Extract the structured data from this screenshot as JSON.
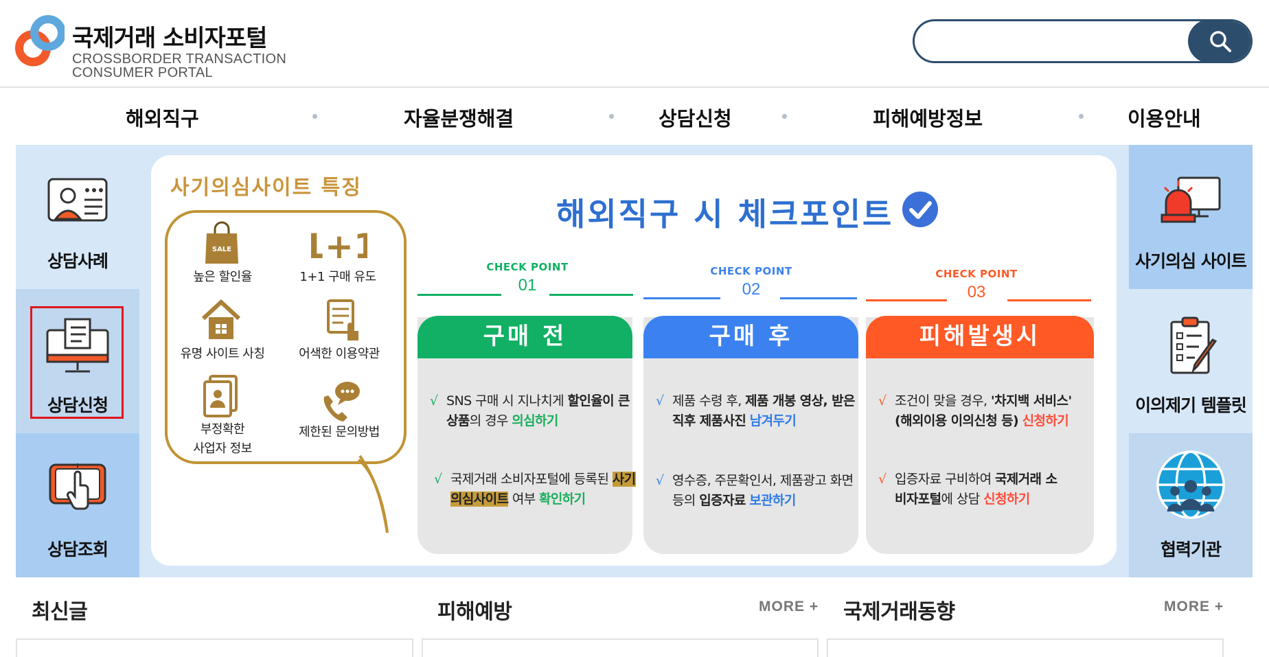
{
  "site": {
    "title": "국제거래 소비자포털",
    "subtitle_line1": "CROSSBORDER TRANSACTION",
    "subtitle_line2": "CONSUMER PORTAL"
  },
  "search": {
    "placeholder": "",
    "value": "",
    "icon": "search-icon"
  },
  "nav": {
    "items": [
      {
        "label": "해외직구"
      },
      {
        "label": "자율분쟁해결"
      },
      {
        "label": "상담신청"
      },
      {
        "label": "피해예방정보"
      },
      {
        "label": "이용안내"
      }
    ]
  },
  "left_menu": [
    {
      "label": "상담사례",
      "icon": "consultation-case-icon",
      "selected": false
    },
    {
      "label": "상담신청",
      "icon": "consultation-request-icon",
      "selected": true
    },
    {
      "label": "상담조회",
      "icon": "consultation-lookup-icon",
      "selected": false
    }
  ],
  "right_menu": [
    {
      "label": "사기의심 사이트",
      "icon": "alert-siren-icon"
    },
    {
      "label": "이의제기 템플릿",
      "icon": "checklist-template-icon"
    },
    {
      "label": "협력기관",
      "icon": "globe-people-icon"
    }
  ],
  "banner": {
    "fraud_title": "사기의심사이트 특징",
    "features": [
      {
        "label": "높은 할인율",
        "icon": "sale-bag-icon",
        "badge": "SALE"
      },
      {
        "label": "1+1 구매 유도",
        "icon": "one-plus-one-icon",
        "badge": "1+1"
      },
      {
        "label": "유명 사이트 사칭",
        "icon": "house-icon"
      },
      {
        "label": "어색한  이용약관",
        "icon": "document-hand-icon"
      },
      {
        "label_line1": "부정확한",
        "label_line2": "사업자 정보",
        "icon": "business-info-icon"
      },
      {
        "label": "제한된 문의방법",
        "icon": "phone-chat-icon"
      }
    ],
    "checkpoint_title": "해외직구 시 체크포인트",
    "checkpoints": [
      {
        "small": "CHECK POINT",
        "number": "01",
        "heading": "구매 전",
        "items": [
          {
            "parts": [
              "SNS 구매 시 지나치게 ",
              "할인율이 큰 상품",
              "의 경우 ",
              "의심하기"
            ]
          },
          {
            "parts": [
              "국제거래 소비자포털에 등록된 ",
              "사기의심사이트",
              " 여부 ",
              "확인하기"
            ]
          }
        ]
      },
      {
        "small": "CHECK POINT",
        "number": "02",
        "heading": "구매 후",
        "items": [
          {
            "parts": [
              "제품 수령 후, ",
              "제품 개봉 영상, 받은 직후 제품사진",
              " ",
              "남겨두기"
            ]
          },
          {
            "parts": [
              "영수증, 주문확인서, 제품광고 화면 등의 ",
              "입증자료",
              " ",
              "보관하기"
            ]
          }
        ]
      },
      {
        "small": "CHECK POINT",
        "number": "03",
        "heading": "피해발생시",
        "items": [
          {
            "parts": [
              "조건이 맞을 경우, ",
              "'차지백 서비스' (해외이용 이의신청 등)",
              " ",
              "신청하기"
            ]
          },
          {
            "parts": [
              "입증자료 구비하여 ",
              "국제거래 소비자포털",
              "에 상담 ",
              "신청하기"
            ]
          }
        ]
      }
    ],
    "tick": "√"
  },
  "sections": [
    {
      "title": "최신글",
      "more": ""
    },
    {
      "title": "피해예방",
      "more": "MORE +"
    },
    {
      "title": "국제거래동향",
      "more": "MORE +"
    }
  ],
  "colors": {
    "navy": "#2d4d6d",
    "green": "#11b064",
    "blue": "#3b82f0",
    "orange": "#ff5a26",
    "gold": "#c09335",
    "band": "#d6e7f8",
    "selected_border": "#e0161d"
  }
}
